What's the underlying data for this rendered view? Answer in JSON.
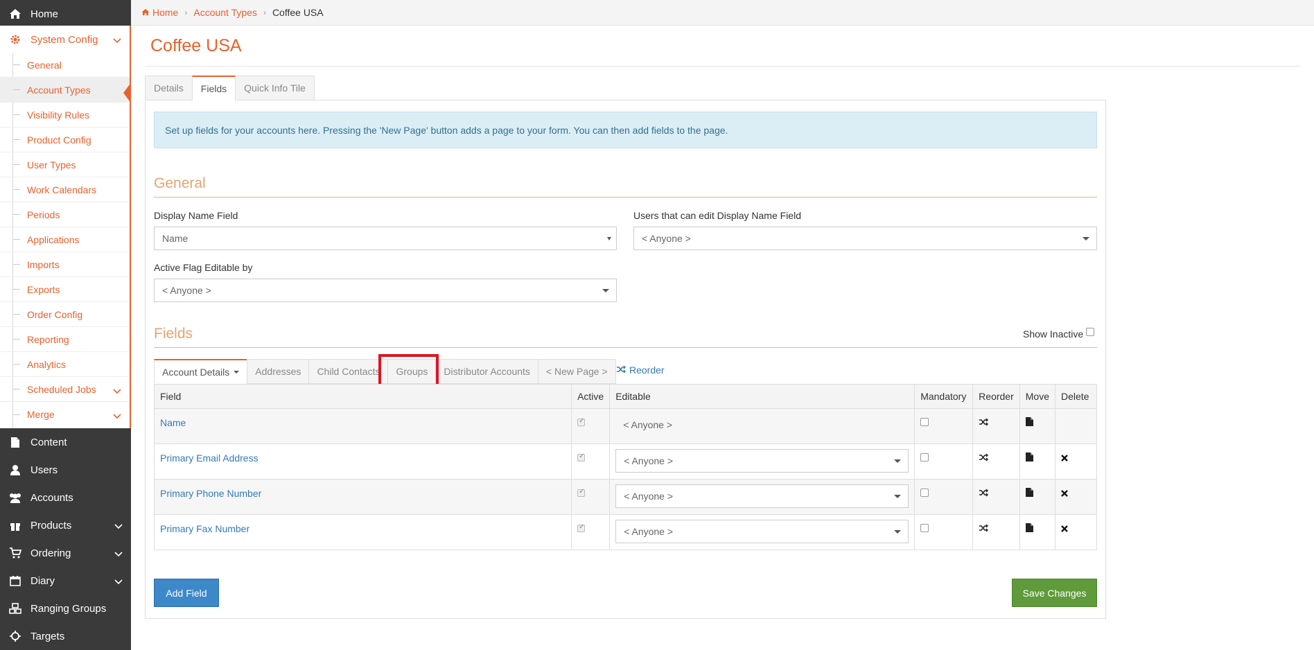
{
  "breadcrumb": {
    "home": "Home",
    "parent": "Account Types",
    "current": "Coffee USA"
  },
  "sidebar": {
    "items": [
      {
        "label": "Home",
        "icon": "home-icon"
      },
      {
        "label": "System Config",
        "icon": "gear-icon"
      },
      {
        "label": "Content",
        "icon": "file-icon"
      },
      {
        "label": "Users",
        "icon": "user-icon"
      },
      {
        "label": "Accounts",
        "icon": "users-group-icon"
      },
      {
        "label": "Products",
        "icon": "gift-icon"
      },
      {
        "label": "Ordering",
        "icon": "cart-icon"
      },
      {
        "label": "Diary",
        "icon": "calendar-icon"
      },
      {
        "label": "Ranging Groups",
        "icon": "cubes-icon"
      },
      {
        "label": "Targets",
        "icon": "crosshair-icon"
      }
    ],
    "submenu": [
      "General",
      "Account Types",
      "Visibility Rules",
      "Product Config",
      "User Types",
      "Work Calendars",
      "Periods",
      "Applications",
      "Imports",
      "Exports",
      "Order Config",
      "Reporting",
      "Analytics",
      "Scheduled Jobs",
      "Merge"
    ]
  },
  "page": {
    "title": "Coffee USA"
  },
  "tabs": [
    "Details",
    "Fields",
    "Quick Info Tile"
  ],
  "info_text": "Set up fields for your accounts here. Pressing the 'New Page' button adds a page to your form. You can then add fields to the page.",
  "general": {
    "title": "General",
    "display_name_label": "Display Name Field",
    "display_name_value": "Name",
    "users_edit_label": "Users that can edit Display Name Field",
    "users_edit_value": "< Anyone >",
    "active_flag_label": "Active Flag Editable by",
    "active_flag_value": "< Anyone >"
  },
  "fields_section": {
    "title": "Fields",
    "show_inactive": "Show Inactive",
    "sub_tabs": [
      "Account Details",
      "Addresses",
      "Child Contacts",
      "Groups",
      "Distributor Accounts",
      "< New Page >"
    ],
    "reorder": "Reorder",
    "columns": [
      "Field",
      "Active",
      "Editable",
      "Mandatory",
      "Reorder",
      "Move",
      "Delete"
    ],
    "rows": [
      {
        "field": "Name",
        "editable": "< Anyone >"
      },
      {
        "field": "Primary Email Address",
        "editable": "< Anyone >"
      },
      {
        "field": "Primary Phone Number",
        "editable": "< Anyone >"
      },
      {
        "field": "Primary Fax Number",
        "editable": "< Anyone >"
      }
    ]
  },
  "buttons": {
    "add_field": "Add Field",
    "save_changes": "Save Changes"
  },
  "colors": {
    "accent": "#e8612c",
    "sidebar_bg": "#3a3a3a",
    "primary": "#3c88c9",
    "success": "#5f9b3a",
    "highlight": "#e0141e"
  }
}
